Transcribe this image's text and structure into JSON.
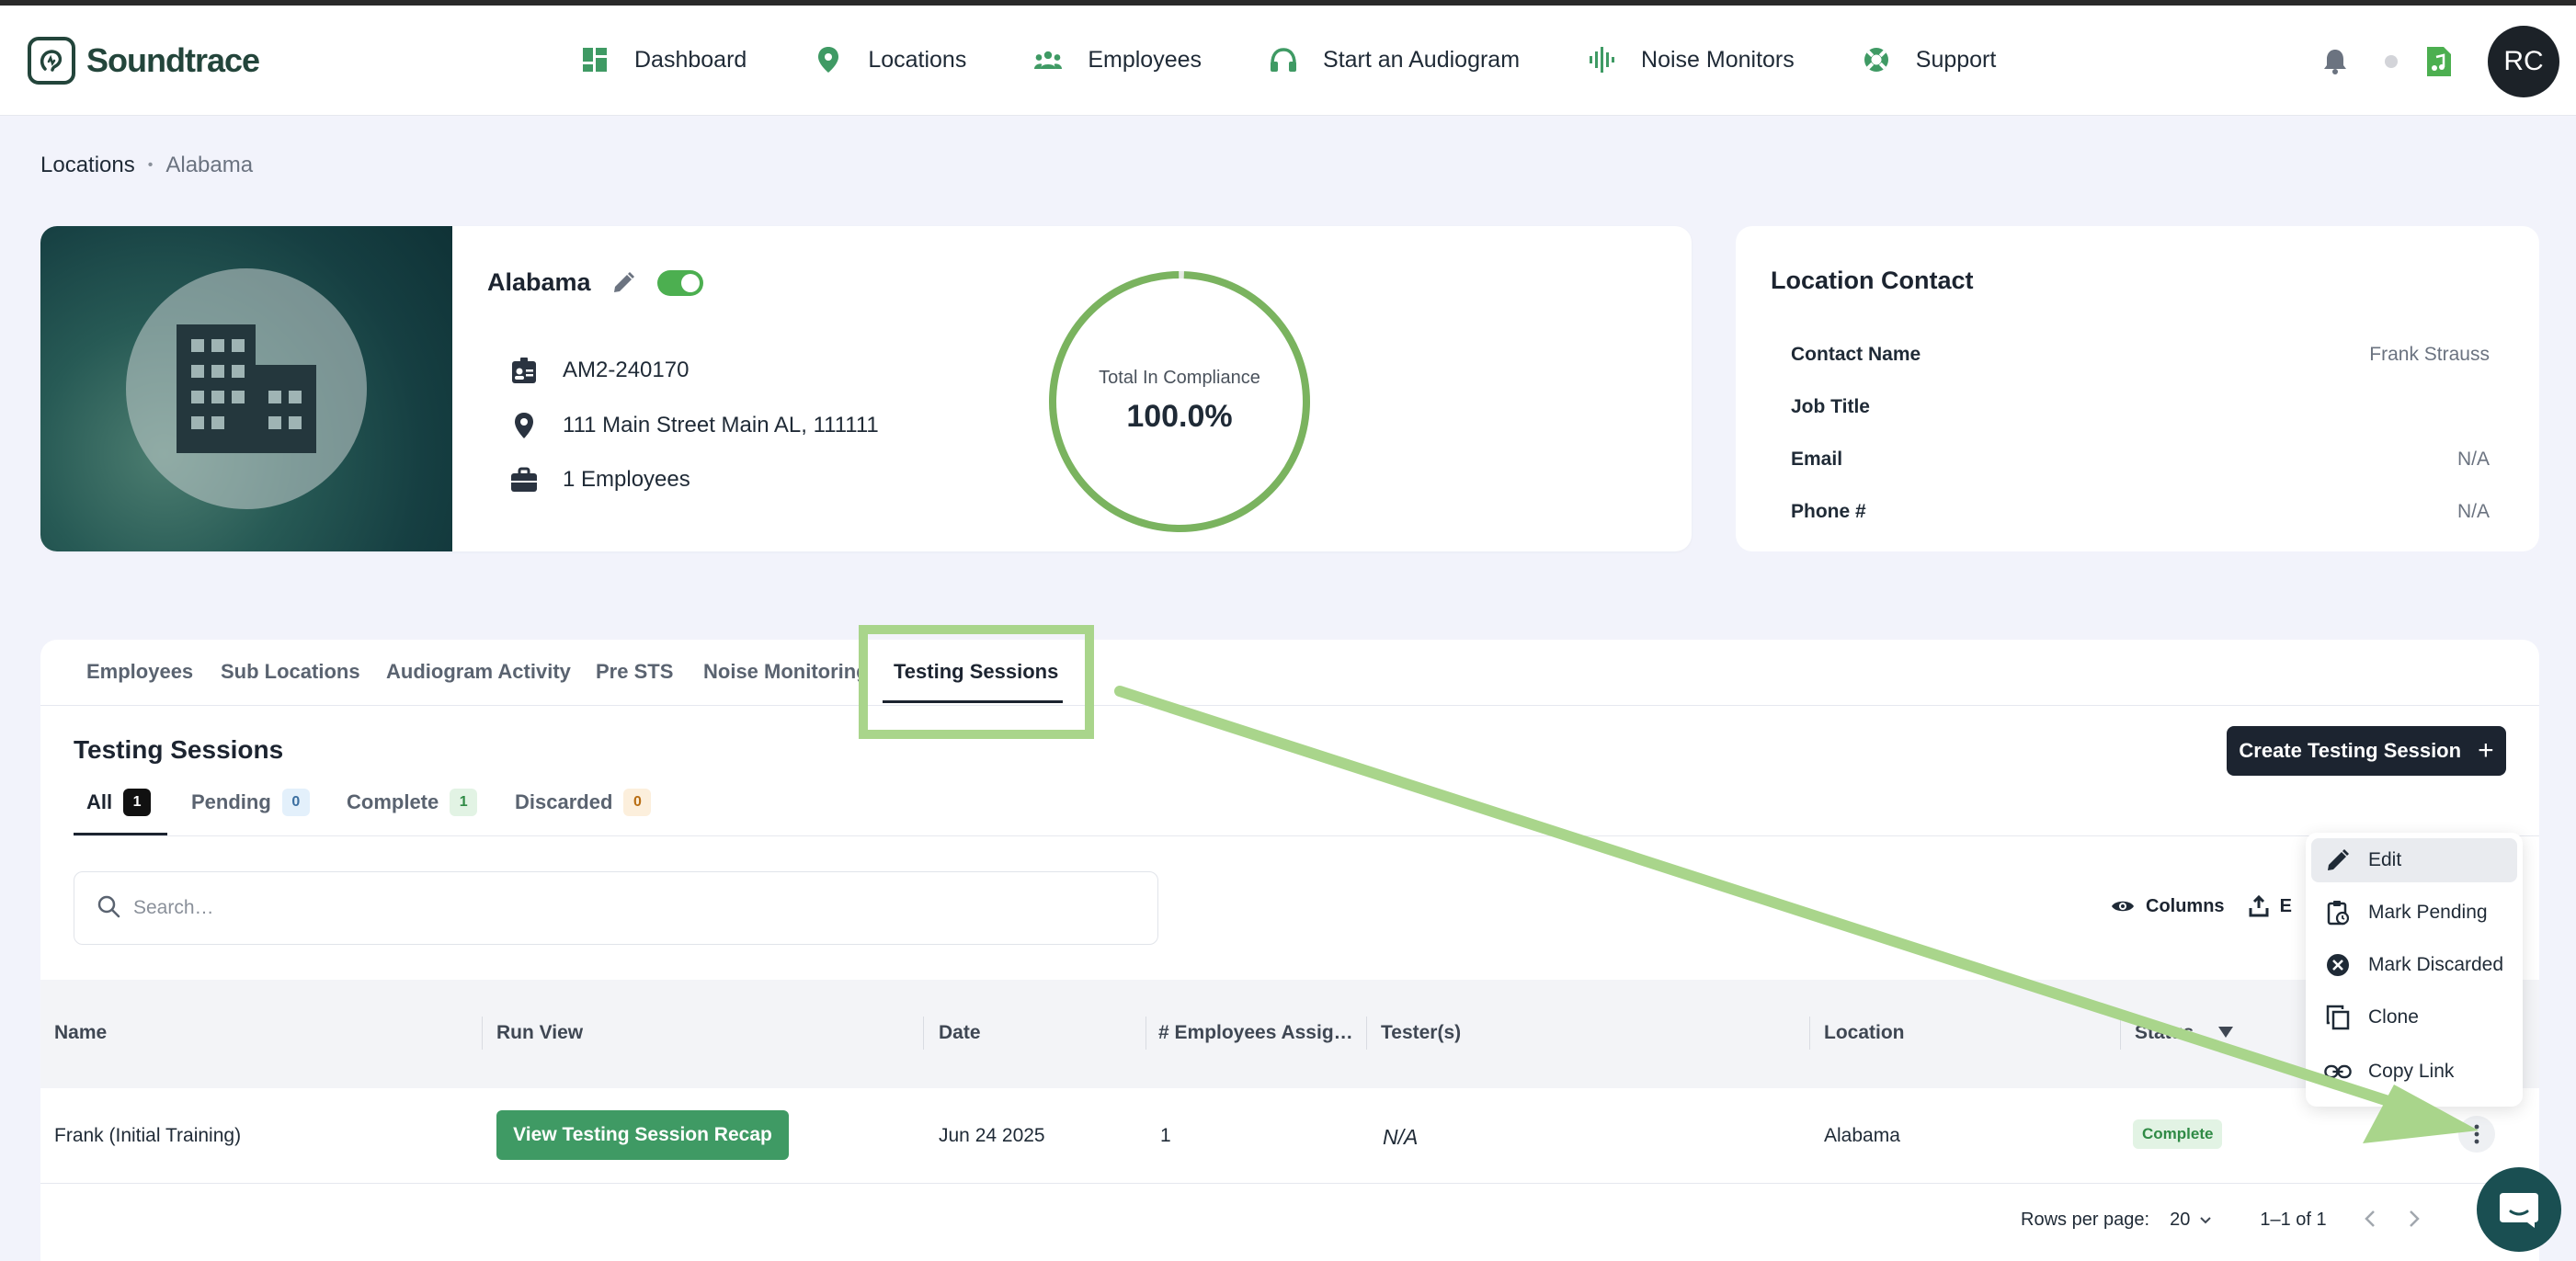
{
  "app": {
    "name": "Soundtrace"
  },
  "nav": {
    "items": [
      {
        "label": "Dashboard",
        "icon": "dashboard-icon"
      },
      {
        "label": "Locations",
        "icon": "location-pin-icon"
      },
      {
        "label": "Employees",
        "icon": "people-icon"
      },
      {
        "label": "Start an Audiogram",
        "icon": "headphones-icon"
      },
      {
        "label": "Noise Monitors",
        "icon": "waveform-icon"
      },
      {
        "label": "Support",
        "icon": "lifebuoy-icon"
      }
    ],
    "avatar_initials": "RC"
  },
  "breadcrumb": {
    "root": "Locations",
    "sep": "•",
    "current": "Alabama"
  },
  "location": {
    "name": "Alabama",
    "active": true,
    "id": "AM2-240170",
    "address": "111 Main Street Main AL, 111111",
    "employees": "1 Employees",
    "compliance_label": "Total In Compliance",
    "compliance_value": "100.0%",
    "compliance_fraction": 1.0
  },
  "contact": {
    "title": "Location Contact",
    "rows": [
      {
        "key": "Contact Name",
        "value": "Frank Strauss"
      },
      {
        "key": "Job Title",
        "value": ""
      },
      {
        "key": "Email",
        "value": "N/A"
      },
      {
        "key": "Phone #",
        "value": "N/A"
      }
    ]
  },
  "tabs": [
    "Employees",
    "Sub Locations",
    "Audiogram Activity",
    "Pre STS",
    "Noise Monitoring",
    "Testing Sessions"
  ],
  "active_tab": "Testing Sessions",
  "sessions": {
    "title": "Testing Sessions",
    "create_label": "Create Testing Session",
    "create_plus": "+",
    "filters": [
      {
        "label": "All",
        "count": "1"
      },
      {
        "label": "Pending",
        "count": "0"
      },
      {
        "label": "Complete",
        "count": "1"
      },
      {
        "label": "Discarded",
        "count": "0"
      }
    ],
    "search_placeholder": "Search…",
    "columns_label": "Columns",
    "export_label": "E",
    "headers": [
      "Name",
      "Run View",
      "Date",
      "# Employees Assig…",
      "Tester(s)",
      "Location",
      "Status"
    ],
    "row": {
      "name": "Frank (Initial Training)",
      "run_view": "View Testing Session Recap",
      "date": "Jun 24 2025",
      "employees": "1",
      "testers": "N/A",
      "location": "Alabama",
      "status": "Complete"
    },
    "rows_per_page_label": "Rows per page:",
    "rows_per_page": "20",
    "range": "1–1 of 1"
  },
  "menu": {
    "items": [
      {
        "label": "Edit",
        "icon": "pencil-icon"
      },
      {
        "label": "Mark Pending",
        "icon": "clipboard-clock-icon"
      },
      {
        "label": "Mark Discarded",
        "icon": "x-circle-icon"
      },
      {
        "label": "Clone",
        "icon": "copy-icon"
      },
      {
        "label": "Copy Link",
        "icon": "link-icon"
      }
    ]
  },
  "colors": {
    "brand": "#23453b",
    "accent": "#3f9a64",
    "annotation": "#a9d58b",
    "dark": "#1c2430"
  }
}
